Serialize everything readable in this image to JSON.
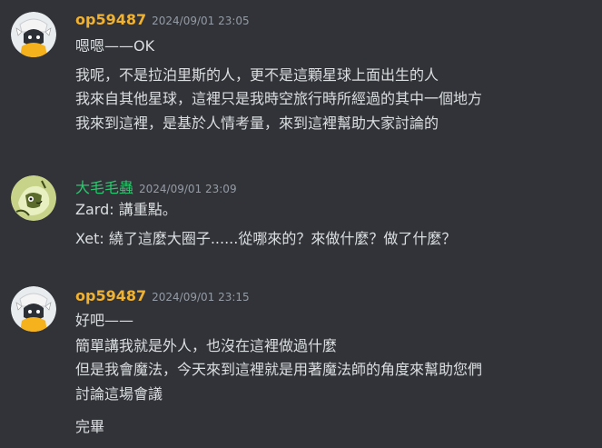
{
  "messages": [
    {
      "username": "op59487",
      "username_color": "#f0b232",
      "timestamp": "2024/09/01 23:05",
      "lines": [
        "嗯嗯——OK",
        "我呢，不是拉泊里斯的人，更不是這顆星球上面出生的人",
        "我來自其他星球，這裡只是我時空旅行時所經過的其中一個地方",
        "我來到這裡，是基於人情考量，來到這裡幫助大家討論的"
      ]
    },
    {
      "username": "大毛毛蟲",
      "username_color": "#2dc770",
      "timestamp": "2024/09/01 23:09",
      "lines": [
        "Zard: 講重點。",
        "Xet: 繞了這麼大圈子......從哪來的？來做什麼？做了什麼？"
      ]
    },
    {
      "username": "op59487",
      "username_color": "#f0b232",
      "timestamp": "2024/09/01 23:15",
      "lines": [
        "好吧——",
        "簡單講我就是外人，也沒在這裡做過什麼",
        "但是我會魔法，今天來到這裡就是用著魔法師的角度來幫助您們",
        "討論這場會議",
        "完畢"
      ]
    }
  ]
}
